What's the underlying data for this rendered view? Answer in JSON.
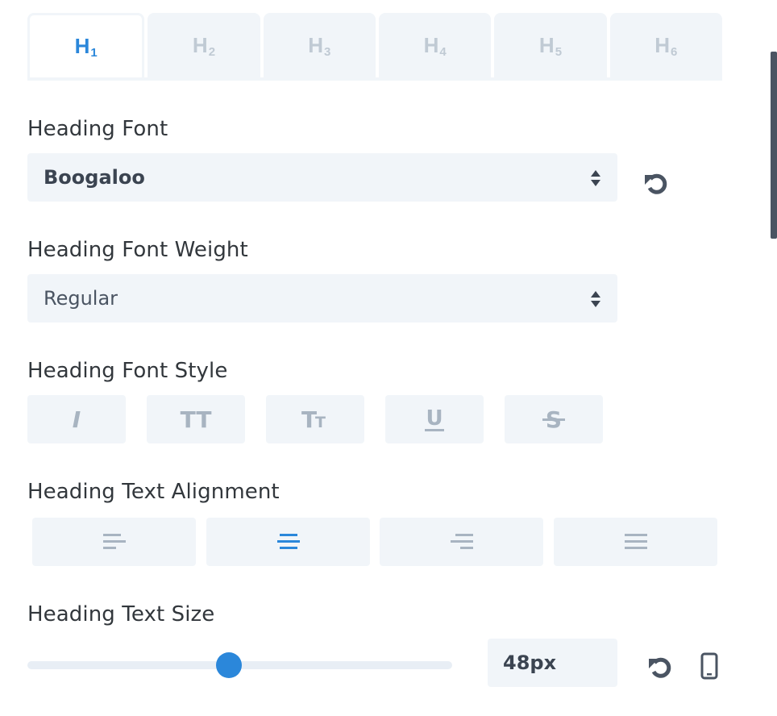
{
  "tabs": [
    {
      "main": "H",
      "sub": "1",
      "active": true
    },
    {
      "main": "H",
      "sub": "2",
      "active": false
    },
    {
      "main": "H",
      "sub": "3",
      "active": false
    },
    {
      "main": "H",
      "sub": "4",
      "active": false
    },
    {
      "main": "H",
      "sub": "5",
      "active": false
    },
    {
      "main": "H",
      "sub": "6",
      "active": false
    }
  ],
  "heading_font": {
    "label": "Heading Font",
    "value": "Boogaloo"
  },
  "heading_font_weight": {
    "label": "Heading Font Weight",
    "value": "Regular"
  },
  "heading_font_style": {
    "label": "Heading Font Style",
    "options": [
      "italic-icon",
      "uppercase-icon",
      "small-caps-icon",
      "underline-icon",
      "strikethrough-icon"
    ],
    "glyphs": {
      "italic": "I",
      "uppercase": "TT",
      "underline": "U",
      "strikethrough": "S",
      "capital": "T",
      "small": "T"
    }
  },
  "heading_text_alignment": {
    "label": "Heading Text Alignment",
    "options": [
      "align-left-icon",
      "align-center-icon",
      "align-right-icon",
      "align-justify-icon"
    ],
    "selected": "center"
  },
  "heading_text_size": {
    "label": "Heading Text Size",
    "value": "48px",
    "slider_fraction": 0.475
  },
  "colors": {
    "accent": "#2b87da",
    "field_bg": "#f1f5f9",
    "muted_icon": "#a8b4c1",
    "text": "#32373c",
    "icon_dark": "#4a5462"
  }
}
